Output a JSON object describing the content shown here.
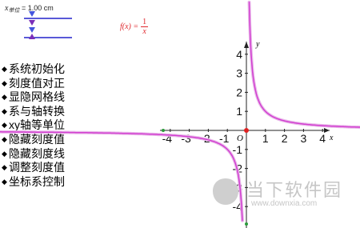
{
  "unit": {
    "var": "x",
    "sub": "单位",
    "value": "= 1.00 cm"
  },
  "formula": {
    "lhs": "f(x) =",
    "numerator": "1",
    "denominator": "x"
  },
  "menu": [
    "系统初始化",
    "刻度值对正",
    "显隐网格线",
    "系与轴转换",
    "xy轴等单位",
    "隐藏刻度值",
    "隐藏刻度线",
    "调整刻度值",
    "坐标系控制"
  ],
  "axes": {
    "x_label": "x",
    "y_label": "y",
    "origin_label": "O",
    "x_ticks": [
      "-4",
      "-3",
      "-2",
      "-1",
      "1",
      "2",
      "3",
      "4"
    ],
    "y_ticks": [
      "4",
      "3",
      "2",
      "1",
      "-1",
      "-2",
      "-3",
      "-4"
    ]
  },
  "chart_data": {
    "type": "line",
    "function": "1/x",
    "xlim": [
      -4.4,
      4.6
    ],
    "ylim": [
      -4.6,
      4.7
    ],
    "series": [
      {
        "color": "#d23fd0",
        "x": [
          -4.5,
          -4,
          -3,
          -2,
          -1,
          -0.5,
          -0.25,
          -0.2,
          0.2,
          0.25,
          0.5,
          1,
          2,
          3,
          4,
          4.6
        ],
        "y": [
          -0.22,
          -0.25,
          -0.33,
          -0.5,
          -1,
          -2,
          -4,
          -5,
          5,
          4,
          2,
          1,
          0.5,
          0.33,
          0.25,
          0.22
        ]
      }
    ]
  },
  "colors": {
    "curve": "#d23fd0",
    "curve_glow": "#e9b9ea",
    "axis": "#222222",
    "formula": "#e0282e",
    "slider_line": "#2222cc",
    "slider_knob": "#7b2fb8",
    "origin_dot": "#e02020",
    "watermark": "#c6c6c6"
  },
  "watermark": {
    "name": "当下软件园",
    "url": "www.downxia.com"
  }
}
